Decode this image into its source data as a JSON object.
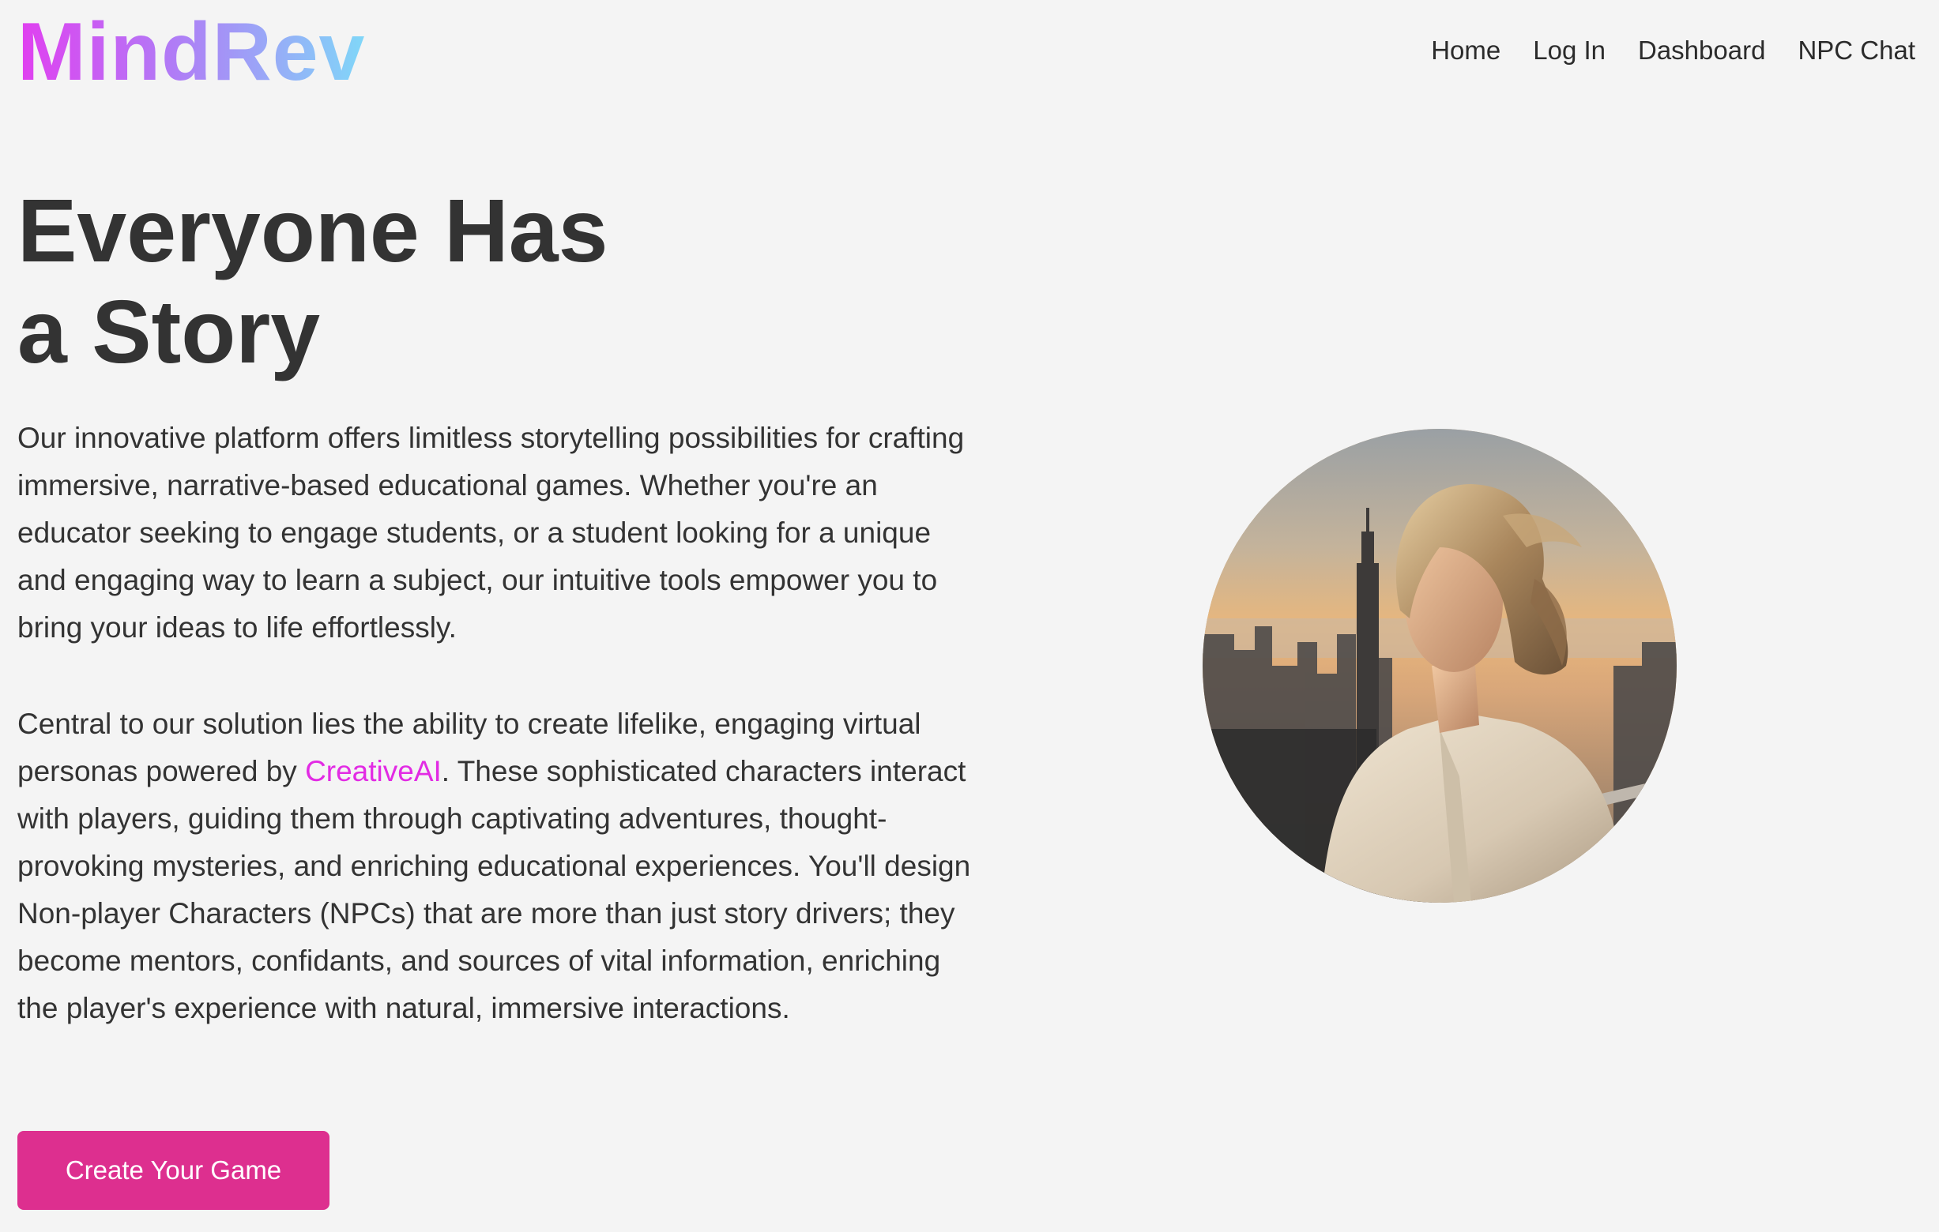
{
  "header": {
    "logo": "MindRev",
    "nav": [
      {
        "label": "Home"
      },
      {
        "label": "Log In"
      },
      {
        "label": "Dashboard"
      },
      {
        "label": "NPC Chat"
      }
    ]
  },
  "hero": {
    "title_line_1": "Everyone Has",
    "title_line_2": "a Story",
    "paragraph_1": "Our innovative platform offers limitless storytelling possibilities for crafting immersive, narrative-based educational games. Whether you're an educator seeking to engage students, or a student looking for a unique and engaging way to learn a subject, our intuitive tools empower you to bring your ideas to life effortlessly.",
    "paragraph_2": {
      "before": "Central to our solution lies the ability to create lifelike, engaging virtual personas powered by ",
      "highlight": "CreativeAI",
      "after": ". These sophisticated characters interact with players, guiding them through captivating adventures, thought-provoking mysteries, and enriching educational experiences. You'll design Non-player Characters (NPCs) that are more than just story drivers; they become mentors, confidants, and sources of vital information, enriching the player's experience with natural, immersive interactions."
    },
    "cta_label": "Create Your Game"
  },
  "colors": {
    "background": "#f4f4f4",
    "text": "#333333",
    "accent_pink": "#dd2f8f",
    "highlight_magenta": "#e22be4",
    "logo_gradient": [
      "#e13ff0",
      "#b07cf6",
      "#80d7f8"
    ]
  }
}
